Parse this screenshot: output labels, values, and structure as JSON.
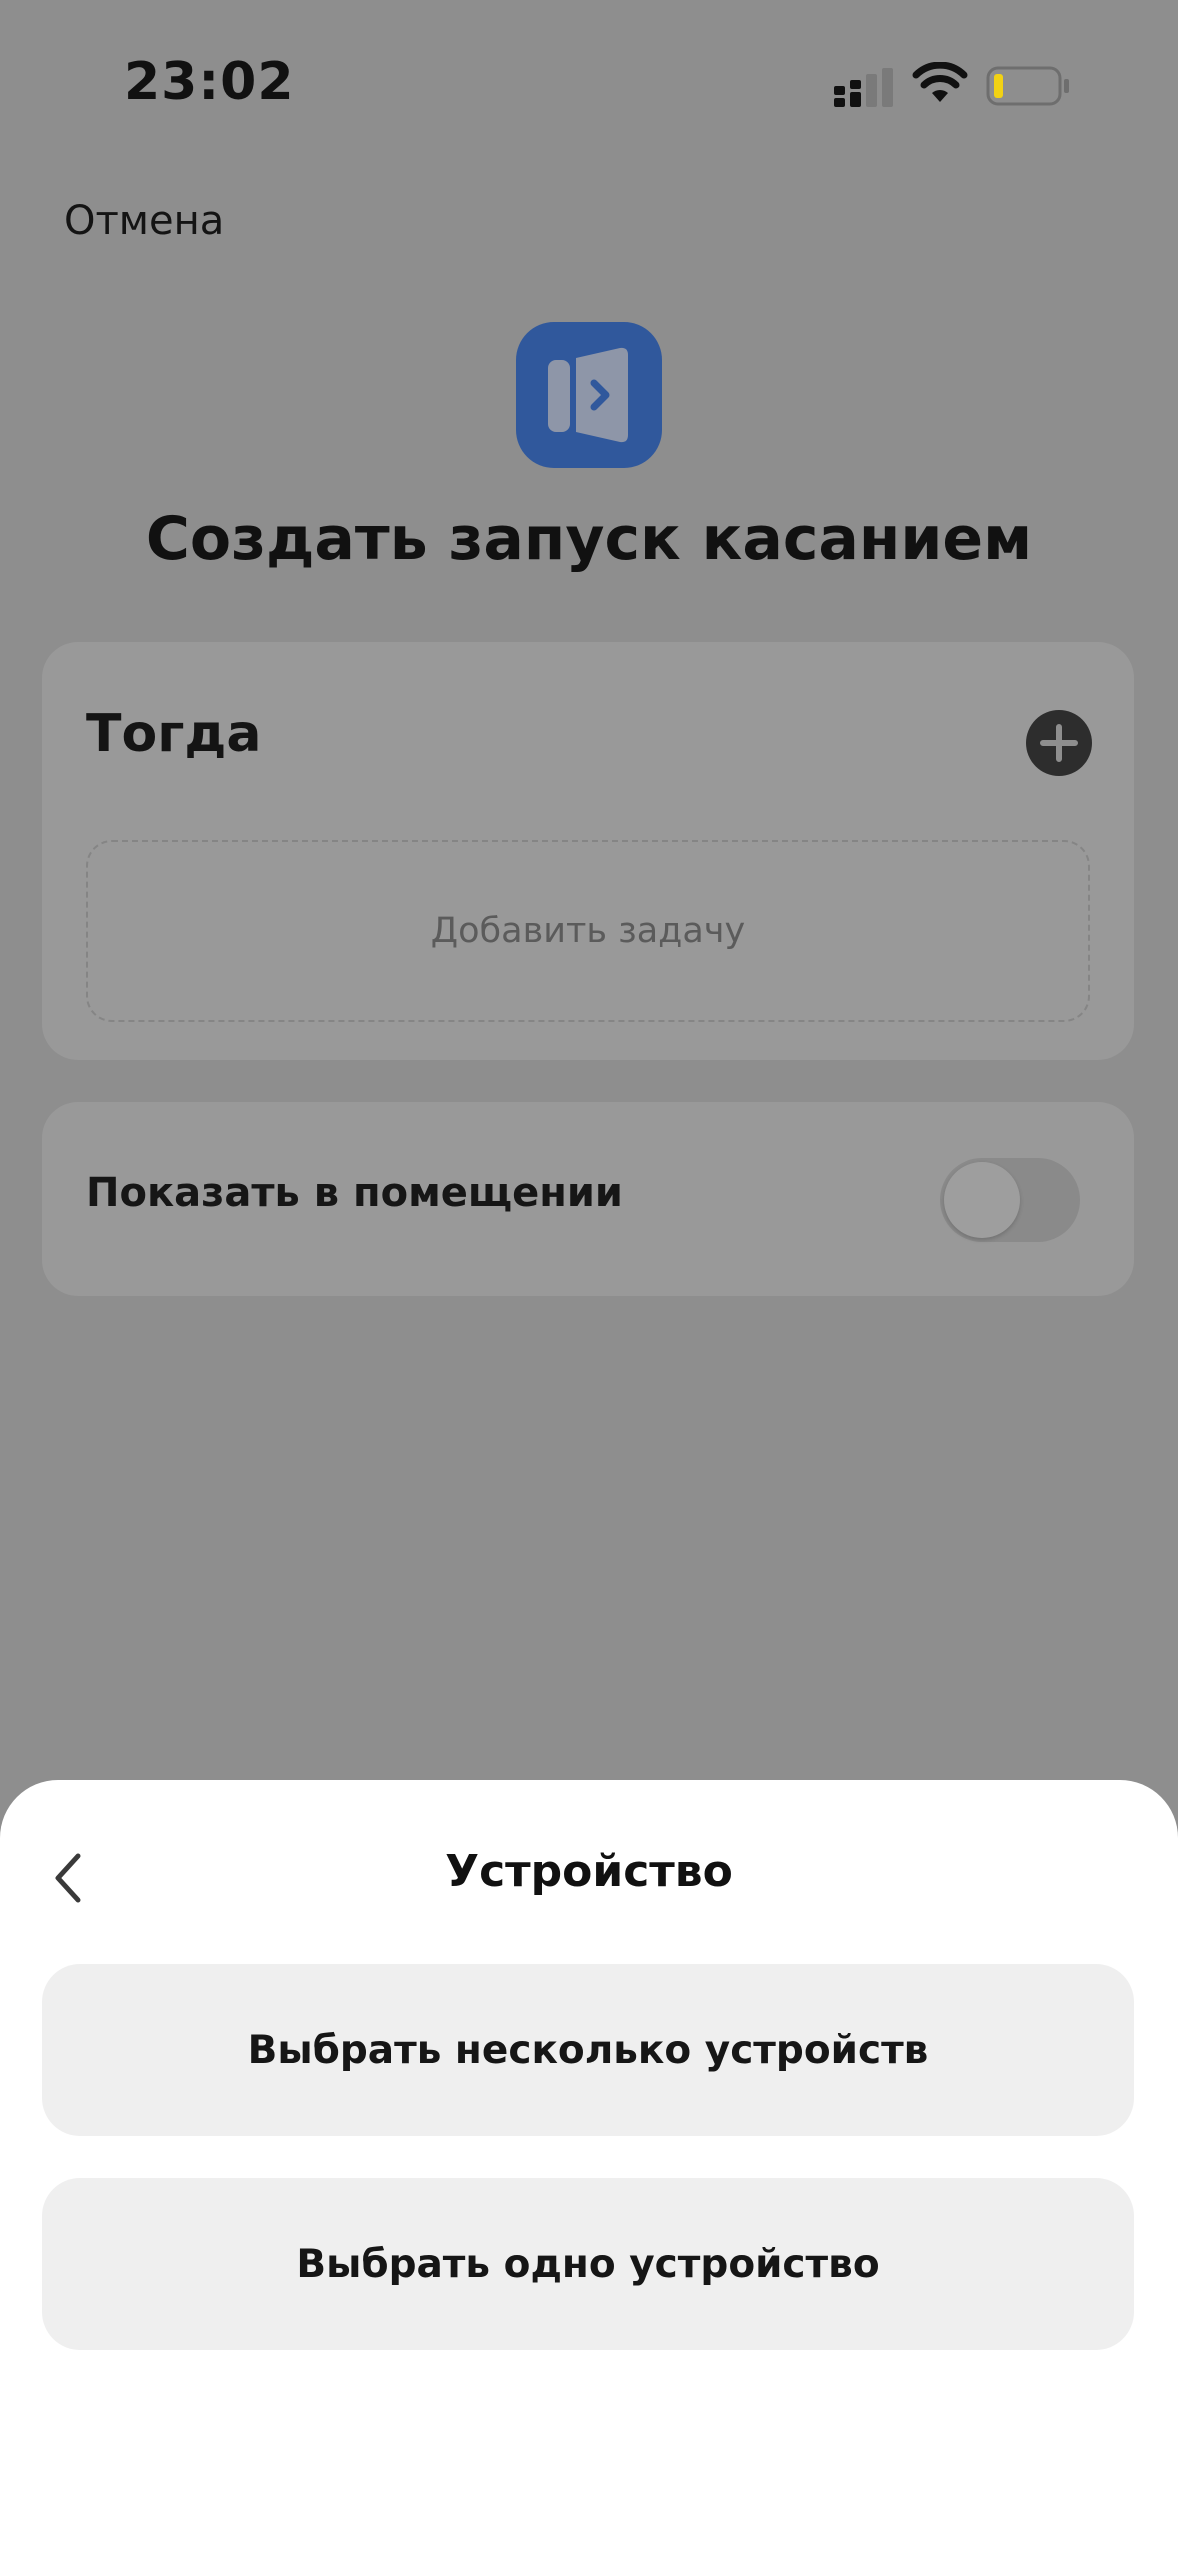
{
  "status_bar": {
    "time": "23:02",
    "icons": [
      "signal-icon",
      "wifi-icon",
      "battery-icon"
    ]
  },
  "header": {
    "cancel_label": "Отмена",
    "app_icon": "tap-to-run-icon",
    "title": "Создать запуск касанием"
  },
  "then_card": {
    "label": "Тогда",
    "add_icon": "plus-icon",
    "add_task_placeholder": "Добавить задачу"
  },
  "room_card": {
    "label": "Показать в помещении",
    "toggle_on": false
  },
  "sheet": {
    "title": "Устройство",
    "back_icon": "chevron-left-icon",
    "options": [
      {
        "label": "Выбрать несколько устройств"
      },
      {
        "label": "Выбрать одно устройство"
      }
    ]
  },
  "colors": {
    "dim_background": "#8e8e8e",
    "card": "#999999",
    "app_icon_bg": "#30589c",
    "sheet_bg": "#ffffff",
    "sheet_button_bg": "#efefef",
    "battery_level": "#f2d214"
  }
}
